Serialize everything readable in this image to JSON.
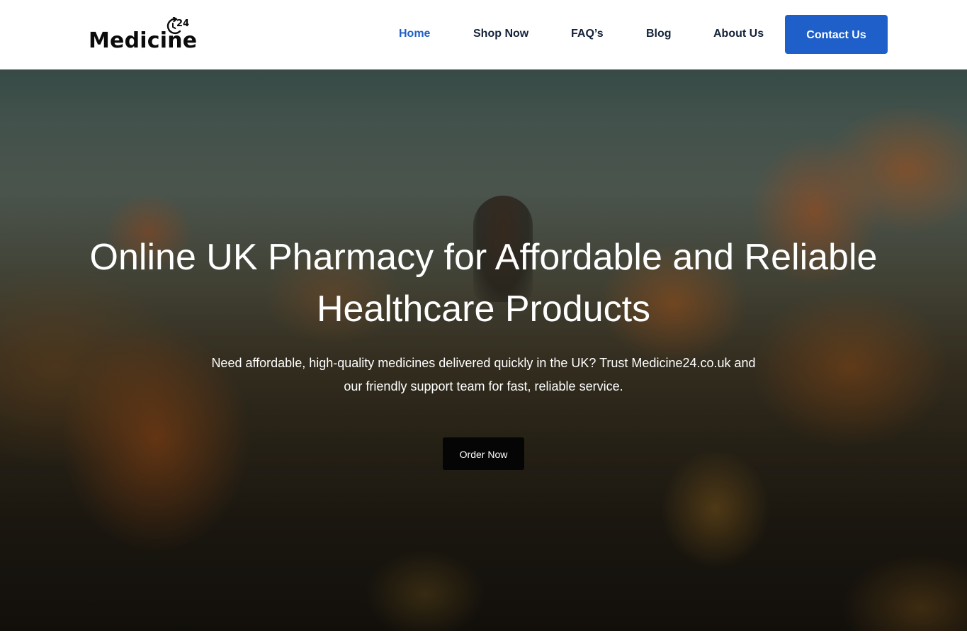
{
  "brand": {
    "name": "Medicine",
    "badge": "24",
    "icon": "clock-arrow-icon"
  },
  "nav": {
    "items": [
      {
        "label": "Home",
        "active": true
      },
      {
        "label": "Shop Now",
        "active": false
      },
      {
        "label": "FAQ’s",
        "active": false
      },
      {
        "label": "Blog",
        "active": false
      },
      {
        "label": "About Us",
        "active": false
      }
    ],
    "cta_label": "Contact Us"
  },
  "hero": {
    "title_line1": "Online UK Pharmacy for Affordable and Reliable",
    "title_line2": "Healthcare Products",
    "subtitle_line1": "Need affordable, high-quality medicines delivered quickly in the UK? Trust Medicine24.co.uk and",
    "subtitle_line2": "our friendly support team for fast, reliable service.",
    "button_label": "Order Now"
  },
  "colors": {
    "accent": "#1f5fc9",
    "active_nav": "#1f5fc4",
    "nav_text": "#14223a",
    "button_dark": "#050505"
  }
}
